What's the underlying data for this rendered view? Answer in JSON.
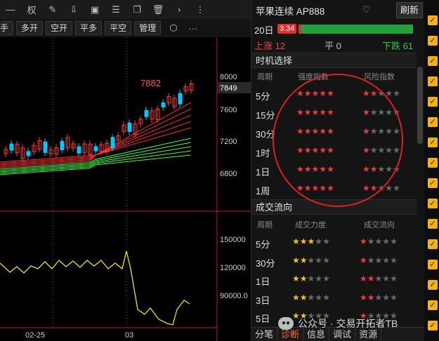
{
  "toolbar1": {
    "icons": [
      "minus-icon",
      "restrict-icon",
      "edit-icon",
      "download-icon",
      "image-icon",
      "settings-icon",
      "copy-icon",
      "delete-icon",
      "chevron-right-icon",
      "more-vertical-icon"
    ],
    "quan_label": "权"
  },
  "toolbar2": {
    "buttons": [
      "手",
      "多开",
      "空开",
      "平多",
      "平空",
      "管理"
    ],
    "more_label": "···"
  },
  "chart": {
    "high_label": "7882",
    "price_axis": [
      "8000",
      "7600",
      "7200",
      "6800"
    ],
    "current_price": "7849",
    "volume_axis": [
      "150000",
      "120000",
      "90000.0"
    ],
    "date_labels": [
      "02-25",
      "03"
    ],
    "colors": {
      "up": "#ff3b3b",
      "down": "#00c8ff",
      "ma_red": "#ff2a2a",
      "ma_green": "#39ff39",
      "volume": "#f5e600"
    }
  },
  "panel": {
    "title": "苹果连续 AP888",
    "refresh_label": "刷新",
    "days_label": "20日",
    "days_value": "3.34",
    "up_label": "上涨 12",
    "flat_label": "平 0",
    "down_label": "下跌 61"
  },
  "timing": {
    "section_title": "时机选择",
    "col_period": "周期",
    "col_strength": "强度指数",
    "col_risk": "风险指数",
    "rows": [
      {
        "period": "5分",
        "strength": 5,
        "risk": 2
      },
      {
        "period": "15分",
        "strength": 5,
        "risk": 1
      },
      {
        "period": "30分",
        "strength": 5,
        "risk": 1
      },
      {
        "period": "1时",
        "strength": 5,
        "risk": 1
      },
      {
        "period": "1日",
        "strength": 4.5,
        "risk": 2
      },
      {
        "period": "1周",
        "strength": 4.5,
        "risk": 2
      }
    ]
  },
  "flow": {
    "section_title": "成交流向",
    "col_period": "周期",
    "col_force": "成交力度",
    "col_direction": "成交流向",
    "rows": [
      {
        "period": "5分",
        "force": 2.5,
        "direction": 1
      },
      {
        "period": "30分",
        "force": 1.5,
        "direction": 1
      },
      {
        "period": "1日",
        "force": 1.5,
        "direction": 1.5
      },
      {
        "period": "3日",
        "force": 2,
        "direction": 1.5
      },
      {
        "period": "5日",
        "force": 2,
        "direction": 1
      }
    ]
  },
  "tabs": [
    "分笔",
    "诊断",
    "信息",
    "调试",
    "资源"
  ],
  "active_tab": "诊断",
  "watermark": "公众号 · 交易开拓者TB",
  "checkbox_count": 16
}
